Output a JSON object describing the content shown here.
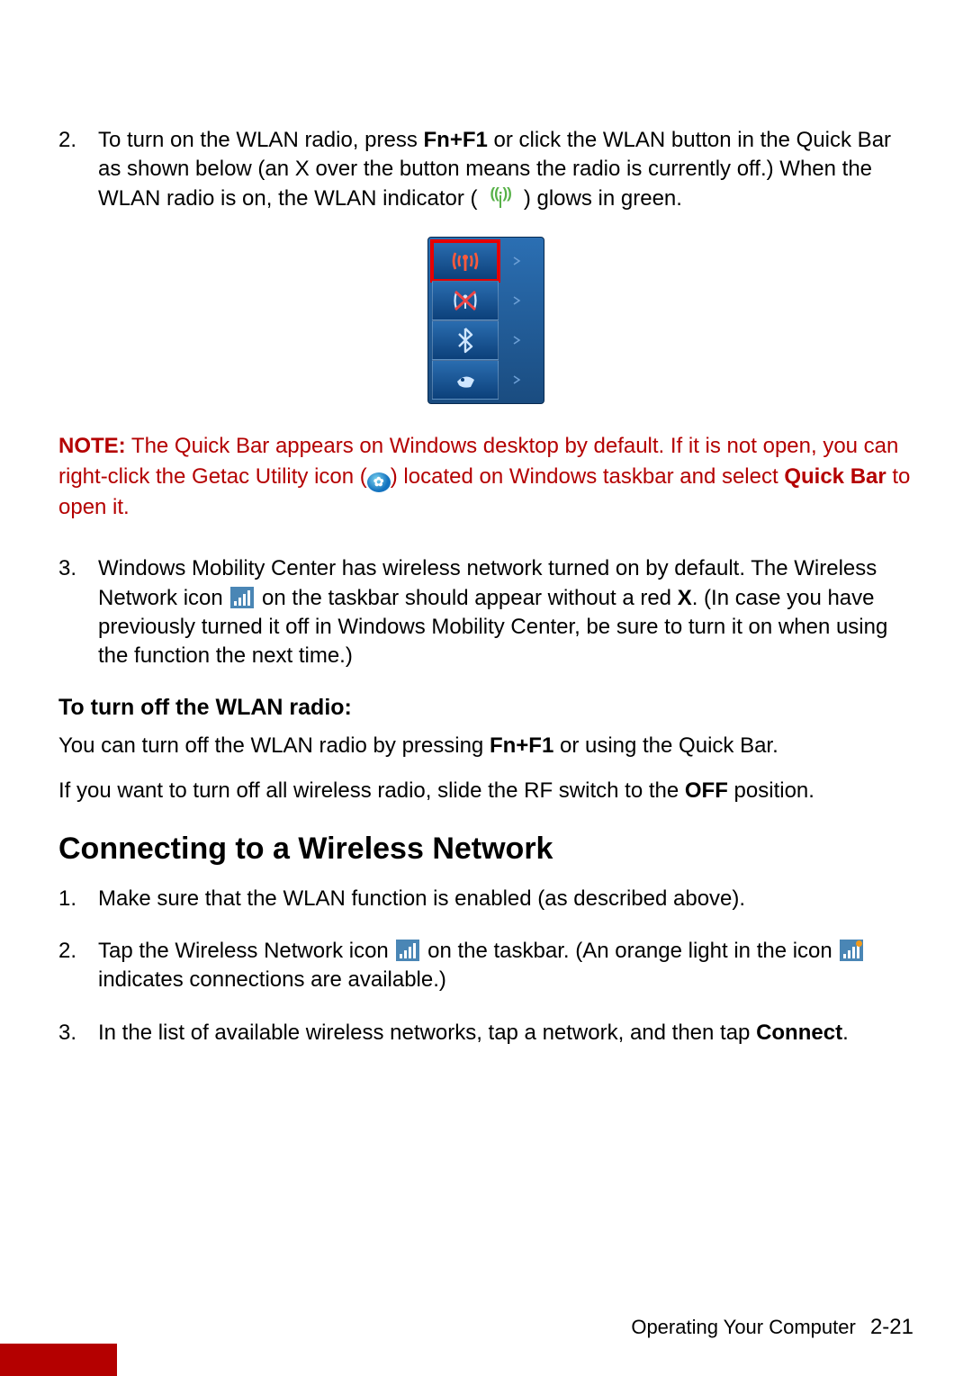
{
  "items": {
    "2": {
      "num": "2.",
      "t1": "To turn on the WLAN radio, press ",
      "k1": "Fn+F1",
      "t2": " or click the WLAN button in the Quick Bar as shown below (an X over the button means the radio is currently off.) When the WLAN radio is on, the WLAN indicator (",
      "t3": ") glows in green."
    },
    "3a": {
      "num": "3.",
      "t1": "Windows Mobility Center has wireless network turned on by default. The Wireless Network icon ",
      "t2": " on the taskbar should appear without a red ",
      "k1": "X",
      "t3": ". (In case you have previously turned it off in Windows Mobility Center, be sure to turn it on when using the function the next time.)"
    }
  },
  "note": {
    "label": "NOTE:",
    "t1": " The Quick Bar appears on Windows desktop by default. If it is not open, you can right-click the Getac Utility icon (",
    "t2": ") located on Windows taskbar and select ",
    "k1": "Quick Bar",
    "t3": " to open it."
  },
  "sub_off": "To turn off the WLAN radio:",
  "p_off1_a": "You can turn off the WLAN radio by pressing ",
  "p_off1_k": "Fn+F1",
  "p_off1_b": " or using the Quick Bar.",
  "p_off2_a": "If you want to turn off all wireless radio, slide the RF switch to the ",
  "p_off2_k": "OFF",
  "p_off2_b": " position.",
  "section": "Connecting to a Wireless Network",
  "conn": {
    "1": {
      "num": "1.",
      "t1": "Make sure that the WLAN function is enabled (as described above)."
    },
    "2": {
      "num": "2.",
      "t1": "Tap the Wireless Network icon ",
      "t2": " on the taskbar. (An orange light in the icon ",
      "t3": " indicates connections are available.)"
    },
    "3": {
      "num": "3.",
      "t1": "In the list of available wireless networks, tap a network, and then tap ",
      "k1": "Connect",
      "t2": "."
    }
  },
  "footer": {
    "chapter": "Operating Your Computer",
    "page": "2-21"
  }
}
